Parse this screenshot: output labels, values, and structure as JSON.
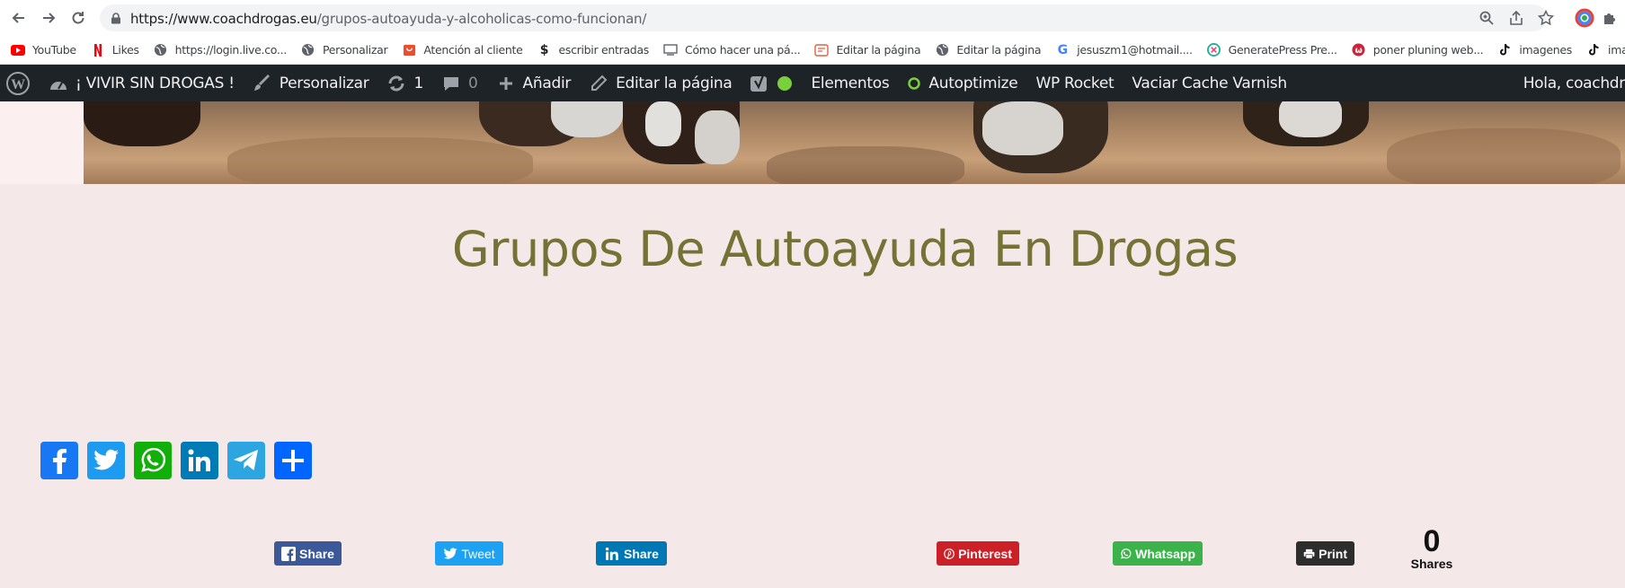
{
  "browser": {
    "url_host": "https://www.coachdrogas.eu",
    "url_path": "/grupos-autoayuda-y-alcoholicas-como-funcionan/"
  },
  "bookmarks": [
    {
      "label": "YouTube",
      "icon": "youtube-icon"
    },
    {
      "label": "Likes",
      "icon": "netflix-icon"
    },
    {
      "label": "https://login.live.co...",
      "icon": "globe-icon"
    },
    {
      "label": "Personalizar",
      "icon": "globe-icon"
    },
    {
      "label": "Atención al cliente",
      "icon": "shop-icon"
    },
    {
      "label": "escribir entradas",
      "icon": "dollar-icon"
    },
    {
      "label": "Cómo hacer una pá...",
      "icon": "page-icon"
    },
    {
      "label": "Editar la página",
      "icon": "edit-page-icon"
    },
    {
      "label": "Editar la página",
      "icon": "globe-icon"
    },
    {
      "label": "jesuszm1@hotmail....",
      "icon": "google-icon"
    },
    {
      "label": "GeneratePress Pre...",
      "icon": "generatepress-icon"
    },
    {
      "label": "poner pluning web...",
      "icon": "plugin-icon"
    },
    {
      "label": "imagenes",
      "icon": "tiktok-icon"
    },
    {
      "label": "imagenes",
      "icon": "tiktok-icon"
    }
  ],
  "admin_bar": {
    "site_name": "¡ VIVIR SIN DROGAS !",
    "customize": "Personalizar",
    "updates_count": "1",
    "comments_count": "0",
    "add_new": "Añadir",
    "edit_page": "Editar la página",
    "elements": "Elementos",
    "autoptimize": "Autoptimize",
    "wp_rocket": "WP Rocket",
    "varnish": "Vaciar Cache Varnish",
    "greeting": "Hola, coachdr"
  },
  "page": {
    "title": "Grupos De Autoayuda En Drogas"
  },
  "share_buttons": {
    "facebook": "Share",
    "twitter": "Tweet",
    "linkedin": "Share",
    "pinterest": "Pinterest",
    "whatsapp": "Whatsapp",
    "print": "Print",
    "shares_count": "0",
    "shares_label": "Shares"
  },
  "colors": {
    "wp_bar": "#1d2327",
    "title": "#767236",
    "facebook": "#1877f2",
    "twitter": "#1d9bf0",
    "whatsapp": "#12af0a",
    "linkedin": "#007bb5",
    "telegram": "#2ca5e0",
    "share_more": "#0166ff",
    "pinterest": "#cb2027",
    "print": "#2d2d2d"
  }
}
